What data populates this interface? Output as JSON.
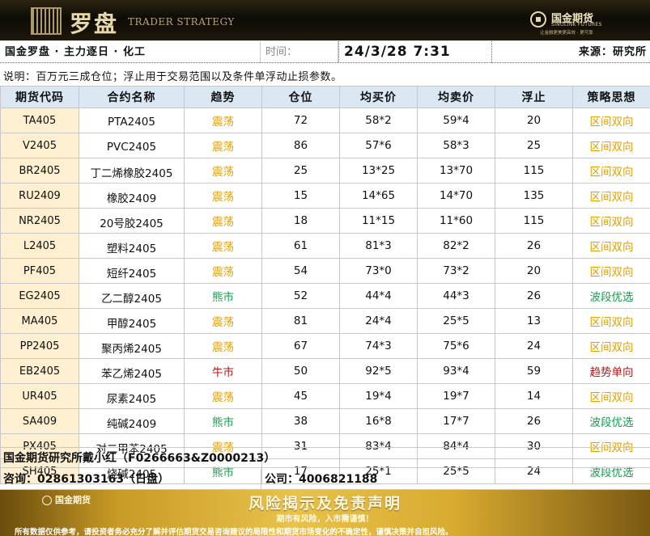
{
  "header": {
    "logo_text": "罗盘",
    "subtitle": "TRADER STRATEGY",
    "brand_name": "国金期货",
    "brand_en": "SINOLINK FUTURES",
    "brand_slogan": "让金融更美更高效 · 更可靠"
  },
  "info": {
    "title": "国金罗盘 · 主力逐日 · 化工",
    "time_label": "时间：",
    "time_value": "24/3/28  7:31",
    "source": "来源：研究所"
  },
  "note": "说明：百万元三成仓位；浮止用于交易范围以及条件单浮动止损参数。",
  "table": {
    "headers": [
      "期货代码",
      "合约名称",
      "趋势",
      "仓位",
      "均买价",
      "均卖价",
      "浮止",
      "策略思想"
    ],
    "rows": [
      {
        "code": "TA405",
        "name": "PTA2405",
        "trend": "震荡",
        "trend_type": "osc",
        "position": "72",
        "buy": "58*2",
        "sell": "59*4",
        "stop": "20",
        "strategy": "区间双向"
      },
      {
        "code": "V2405",
        "name": "PVC2405",
        "trend": "震荡",
        "trend_type": "osc",
        "position": "86",
        "buy": "57*6",
        "sell": "58*3",
        "stop": "25",
        "strategy": "区间双向"
      },
      {
        "code": "BR2405",
        "name": "丁二烯橡胶2405",
        "trend": "震荡",
        "trend_type": "osc",
        "position": "25",
        "buy": "13*25",
        "sell": "13*70",
        "stop": "115",
        "strategy": "区间双向"
      },
      {
        "code": "RU2409",
        "name": "橡胶2409",
        "trend": "震荡",
        "trend_type": "osc",
        "position": "15",
        "buy": "14*65",
        "sell": "14*70",
        "stop": "135",
        "strategy": "区间双向"
      },
      {
        "code": "NR2405",
        "name": "20号胶2405",
        "trend": "震荡",
        "trend_type": "osc",
        "position": "18",
        "buy": "11*15",
        "sell": "11*60",
        "stop": "115",
        "strategy": "区间双向"
      },
      {
        "code": "L2405",
        "name": "塑料2405",
        "trend": "震荡",
        "trend_type": "osc",
        "position": "61",
        "buy": "81*3",
        "sell": "82*2",
        "stop": "26",
        "strategy": "区间双向"
      },
      {
        "code": "PF405",
        "name": "短纤2405",
        "trend": "震荡",
        "trend_type": "osc",
        "position": "54",
        "buy": "73*0",
        "sell": "73*2",
        "stop": "20",
        "strategy": "区间双向"
      },
      {
        "code": "EG2405",
        "name": "乙二醇2405",
        "trend": "熊市",
        "trend_type": "bear",
        "position": "52",
        "buy": "44*4",
        "sell": "44*3",
        "stop": "26",
        "strategy": "波段优选"
      },
      {
        "code": "MA405",
        "name": "甲醇2405",
        "trend": "震荡",
        "trend_type": "osc",
        "position": "81",
        "buy": "24*4",
        "sell": "25*5",
        "stop": "13",
        "strategy": "区间双向"
      },
      {
        "code": "PP2405",
        "name": "聚丙烯2405",
        "trend": "震荡",
        "trend_type": "osc",
        "position": "67",
        "buy": "74*3",
        "sell": "75*6",
        "stop": "24",
        "strategy": "区间双向"
      },
      {
        "code": "EB2405",
        "name": "苯乙烯2405",
        "trend": "牛市",
        "trend_type": "bull",
        "position": "50",
        "buy": "92*5",
        "sell": "93*4",
        "stop": "59",
        "strategy": "趋势单向"
      },
      {
        "code": "UR405",
        "name": "尿素2405",
        "trend": "震荡",
        "trend_type": "osc",
        "position": "45",
        "buy": "19*4",
        "sell": "19*7",
        "stop": "14",
        "strategy": "区间双向"
      },
      {
        "code": "SA409",
        "name": "纯碱2409",
        "trend": "熊市",
        "trend_type": "bear",
        "position": "38",
        "buy": "16*8",
        "sell": "17*7",
        "stop": "26",
        "strategy": "波段优选"
      },
      {
        "code": "PX405",
        "name": "对二甲苯2405",
        "trend": "震荡",
        "trend_type": "osc",
        "position": "31",
        "buy": "83*4",
        "sell": "84*4",
        "stop": "30",
        "strategy": "区间双向"
      },
      {
        "code": "SH405",
        "name": "烧碱2405",
        "trend": "熊市",
        "trend_type": "bear",
        "position": "17",
        "buy": "25*1",
        "sell": "25*5",
        "stop": "24",
        "strategy": "波段优选"
      }
    ]
  },
  "contact": {
    "author": "国金期货研究所戴小红（F0266663&Z0000213）",
    "consult": "咨询：02861303163（日盘）",
    "company": "公司：4006821188"
  },
  "footer": {
    "logo": "国金期货",
    "title": "风险揭示及免责声明",
    "sub": "期市有风险，入市需谨慎！",
    "small": "所有数据仅供参考，请投资者务必充分了解并评估期货交易咨询建议的局限性和期货市场变化的不确定性，谨慎决策并自担风险。"
  },
  "colors": {
    "osc": "#e0a000",
    "bear": "#1a9a50",
    "bull": "#b01818",
    "code_bg": "#fdefd0",
    "header_bg": "#dbe8f4"
  }
}
